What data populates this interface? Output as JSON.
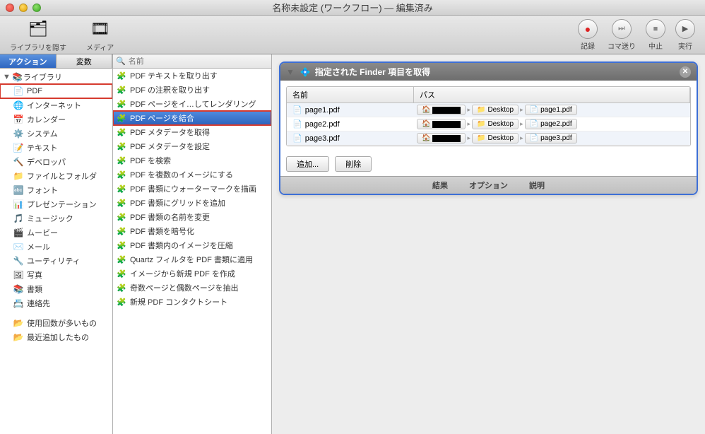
{
  "window": {
    "title": "名称未設定 (ワークフロー) — 編集済み"
  },
  "toolbar": {
    "hideLibrary": "ライブラリを隠す",
    "media": "メディア",
    "record": "記録",
    "step": "コマ送り",
    "stop": "中止",
    "run": "実行"
  },
  "tabs": {
    "action": "アクション",
    "variable": "変数"
  },
  "search": {
    "placeholder": "名前"
  },
  "sidebar": {
    "libraryLabel": "ライブラリ",
    "items": [
      {
        "icon": "📄",
        "label": "PDF",
        "highlighted": true
      },
      {
        "icon": "🌐",
        "label": "インターネット"
      },
      {
        "icon": "📅",
        "label": "カレンダー"
      },
      {
        "icon": "⚙️",
        "label": "システム"
      },
      {
        "icon": "📝",
        "label": "テキスト"
      },
      {
        "icon": "🔨",
        "label": "デベロッパ"
      },
      {
        "icon": "📁",
        "label": "ファイルとフォルダ"
      },
      {
        "icon": "🔤",
        "label": "フォント"
      },
      {
        "icon": "📊",
        "label": "プレゼンテーション"
      },
      {
        "icon": "🎵",
        "label": "ミュージック"
      },
      {
        "icon": "🎬",
        "label": "ムービー"
      },
      {
        "icon": "✉️",
        "label": "メール"
      },
      {
        "icon": "🔧",
        "label": "ユーティリティ"
      },
      {
        "icon": "🖼",
        "label": "写真"
      },
      {
        "icon": "📚",
        "label": "書類"
      },
      {
        "icon": "📇",
        "label": "連絡先"
      }
    ],
    "smart": [
      {
        "icon": "📂",
        "label": "使用回数が多いもの"
      },
      {
        "icon": "📂",
        "label": "最近追加したもの"
      }
    ]
  },
  "actionList": [
    {
      "label": "PDF テキストを取り出す"
    },
    {
      "label": "PDF の注釈を取り出す"
    },
    {
      "label": "PDF ページをイ…してレンダリング"
    },
    {
      "label": "PDF ページを結合",
      "selected": true,
      "highlighted": true
    },
    {
      "label": "PDF メタデータを取得"
    },
    {
      "label": "PDF メタデータを設定"
    },
    {
      "label": "PDF を検索"
    },
    {
      "label": "PDF を複数のイメージにする"
    },
    {
      "label": "PDF 書類にウォーターマークを描画"
    },
    {
      "label": "PDF 書類にグリッドを追加"
    },
    {
      "label": "PDF 書類の名前を変更"
    },
    {
      "label": "PDF 書類を暗号化"
    },
    {
      "label": "PDF 書類内のイメージを圧縮"
    },
    {
      "label": "Quartz フィルタを PDF 書類に適用"
    },
    {
      "label": "イメージから新規 PDF を作成"
    },
    {
      "label": "奇数ページと偶数ページを抽出"
    },
    {
      "label": "新規 PDF コンタクトシート"
    }
  ],
  "actionCard": {
    "title": "指定された Finder 項目を取得",
    "columns": {
      "name": "名前",
      "path": "パス"
    },
    "rows": [
      {
        "name": "page1.pdf",
        "folder": "Desktop",
        "file": "page1.pdf"
      },
      {
        "name": "page2.pdf",
        "folder": "Desktop",
        "file": "page2.pdf"
      },
      {
        "name": "page3.pdf",
        "folder": "Desktop",
        "file": "page3.pdf"
      }
    ],
    "addBtn": "追加...",
    "removeBtn": "削除",
    "footer": {
      "results": "結果",
      "options": "オプション",
      "description": "説明"
    }
  }
}
